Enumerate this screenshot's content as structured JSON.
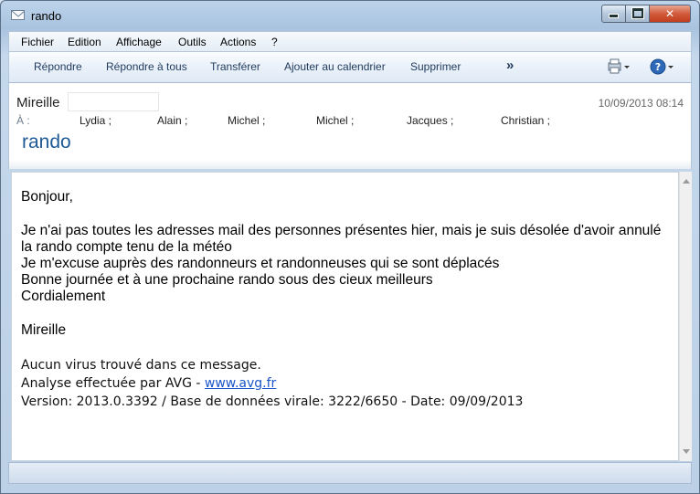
{
  "window": {
    "title": "rando",
    "accent": "#1f5a96"
  },
  "menu": {
    "items": [
      {
        "label": "Fichier"
      },
      {
        "label": "Edition"
      },
      {
        "label": "Affichage"
      },
      {
        "label": "Outils"
      },
      {
        "label": "Actions"
      },
      {
        "label": "?"
      }
    ]
  },
  "toolbar": {
    "reply": "Répondre",
    "reply_all": "Répondre à tous",
    "forward": "Transférer",
    "add_calendar": "Ajouter au calendrier",
    "delete": "Supprimer",
    "more": "»"
  },
  "message": {
    "sender": "Mireille",
    "datetime": "10/09/2013 08:14",
    "to_label": "À :",
    "recipients": [
      "Lydia ;",
      "Alain ;",
      "Michel ;",
      "Michel ;",
      "Jacques ;",
      "Christian ;"
    ],
    "subject": "rando",
    "body": {
      "greeting": "Bonjour,",
      "line1": "Je n'ai pas toutes les adresses mail des personnes présentes hier, mais je suis désolée d'avoir annulé",
      "line2": "la rando compte tenu de la météo",
      "line3": "Je m'excuse auprès des randonneurs et randonneuses qui se sont déplacés",
      "line4": "Bonne journée et à une prochaine rando sous des cieux meilleurs",
      "line5": "Cordialement",
      "signature": "Mireille"
    },
    "antivirus": {
      "line1": "Aucun virus trouvé dans ce message.",
      "line2_prefix": "Analyse effectuée par AVG - ",
      "link": "www.avg.fr",
      "line3": "Version: 2013.0.3392 / Base de données virale: 3222/6650 - Date: 09/09/2013"
    }
  }
}
